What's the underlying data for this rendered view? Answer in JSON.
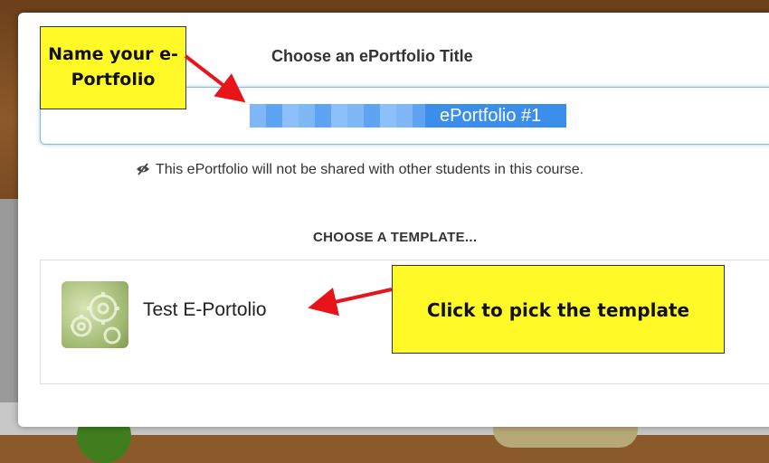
{
  "modal": {
    "title": "Choose an ePortfolio Title",
    "title_input": {
      "value": "ePortfolio #1"
    },
    "share_note": "This ePortfolio will not be shared with other students in this course.",
    "template_heading": "CHOOSE A TEMPLATE...",
    "templates": [
      {
        "label": "Test E-Portolio",
        "icon": "gears-icon"
      }
    ]
  },
  "annotations": {
    "name_callout_line1": "Name your e-",
    "name_callout_line2": "Portfolio",
    "pick_callout": "Click to pick the template"
  },
  "colors": {
    "callout_bg": "#fff927",
    "arrow": "#e8141c",
    "selection": "#3b8eea",
    "input_focus_border": "#88b8e6"
  }
}
